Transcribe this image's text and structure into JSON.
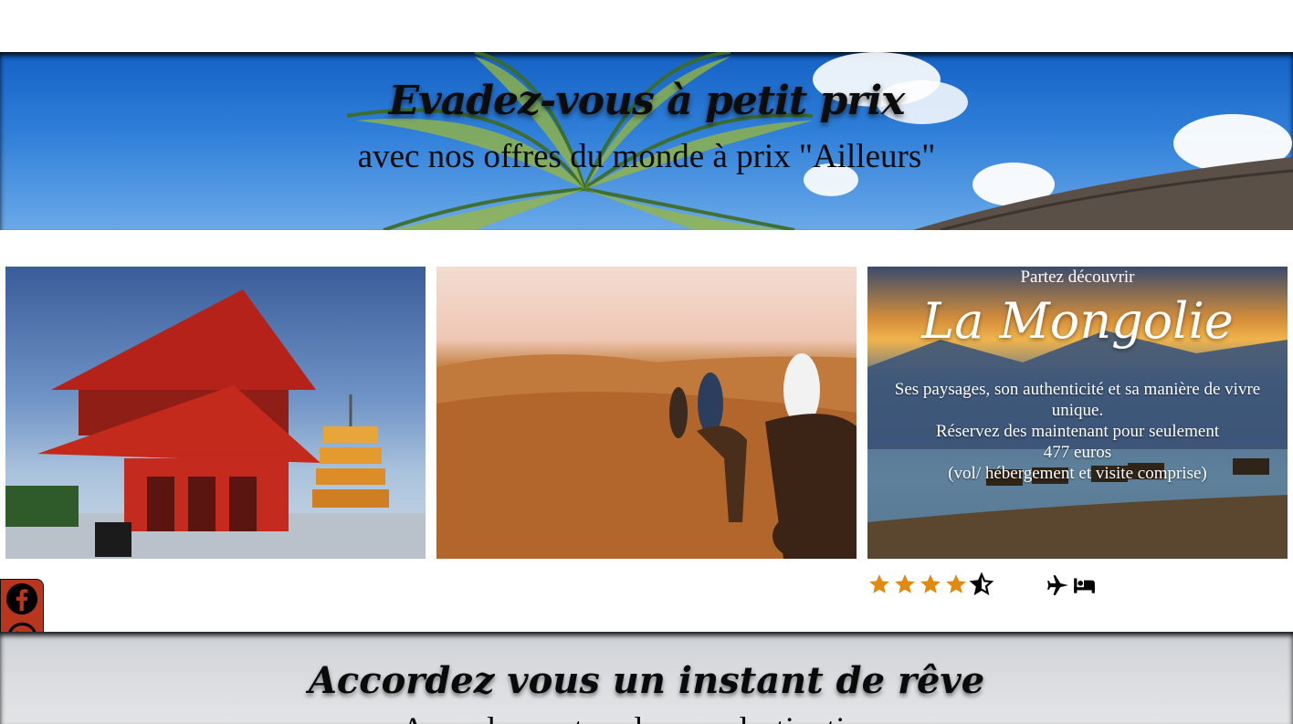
{
  "hero": {
    "title": "Evadez-vous à petit prix",
    "subtitle": "avec nos offres du monde à prix \"Ailleurs\""
  },
  "offer": {
    "pretitle": "Partez découvrir",
    "destination": "La Mongolie",
    "description_line1": "Ses paysages, son authenticité et sa manière de vivre unique.",
    "description_line2": "Réservez des maintenant pour seulement",
    "price": "477 euros",
    "includes": "(vol/ hébergement et visite comprise)",
    "rating": 4.5,
    "amenity_icons": [
      "plane-icon",
      "bed-icon"
    ]
  },
  "images": [
    {
      "name": "japan-temple-image"
    },
    {
      "name": "desert-camels-image"
    },
    {
      "name": "mongolia-image"
    }
  ],
  "social": [
    "facebook-icon",
    "whatsapp-icon",
    "email-icon"
  ],
  "colors": {
    "star": "#e08a12",
    "social_bg": "#b8361d"
  },
  "dream": {
    "title": "Accordez vous un instant de rêve",
    "subtitle": "Avec de nos top des ces destinations"
  }
}
